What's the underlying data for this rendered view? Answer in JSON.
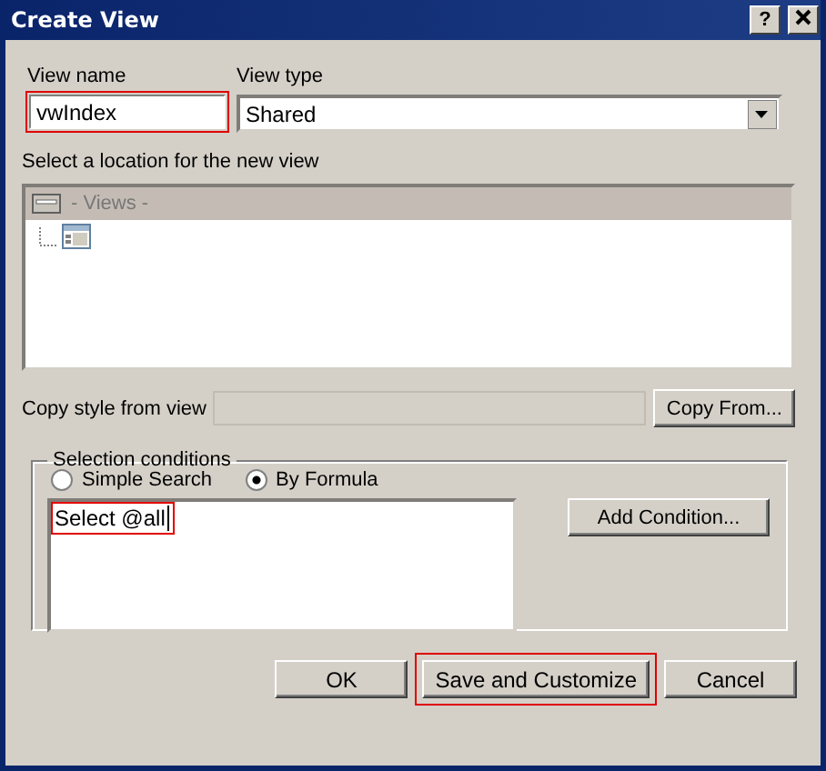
{
  "window": {
    "title": "Create View"
  },
  "help_button": {
    "label": "?"
  },
  "view_name": {
    "label": "View name",
    "value": "vwIndex",
    "highlighted": true
  },
  "view_type": {
    "label": "View type",
    "value": "Shared"
  },
  "location": {
    "label": "Select a location for the new view",
    "tree": [
      {
        "label": "- Views -",
        "selected": true,
        "children": [
          {
            "selected": false
          }
        ]
      }
    ]
  },
  "copy_style": {
    "label": "Copy style from view",
    "button": "Copy From..."
  },
  "selection_conditions": {
    "legend": "Selection conditions",
    "options": [
      {
        "label": "Simple Search",
        "selected": false
      },
      {
        "label": "By Formula",
        "selected": true
      }
    ],
    "formula": {
      "value": "Select @all",
      "highlighted": true
    },
    "button": "Add Condition..."
  },
  "buttons": [
    {
      "label": "OK",
      "highlighted": false
    },
    {
      "label": "Save and Customize",
      "highlighted": true
    },
    {
      "label": "Cancel",
      "highlighted": false
    }
  ]
}
